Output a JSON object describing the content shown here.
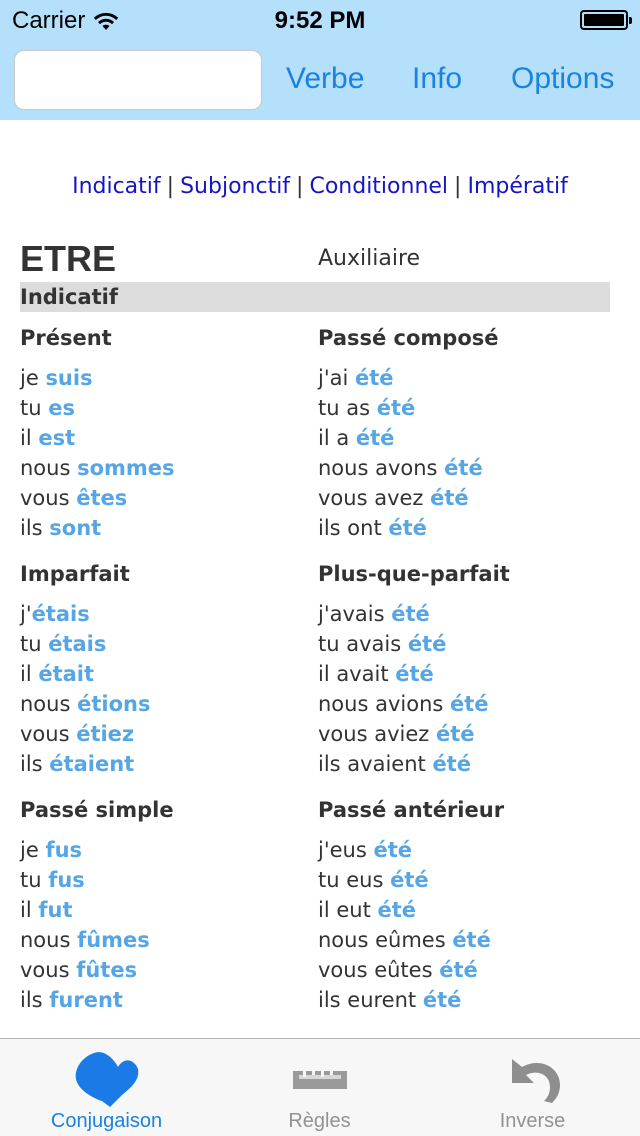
{
  "status_bar": {
    "carrier": "Carrier",
    "time": "9:52 PM"
  },
  "nav": {
    "search_value": "",
    "verbe": "Verbe",
    "info": "Info",
    "options": "Options"
  },
  "modes": [
    "Indicatif",
    "Subjonctif",
    "Conditionnel",
    "Impératif"
  ],
  "mode_separator": "|",
  "verb": {
    "name": "ETRE",
    "type": "Auxiliaire"
  },
  "mood_header": "Indicatif",
  "tenses": [
    {
      "title": "Présent",
      "forms": [
        [
          "je ",
          "suis"
        ],
        [
          "tu ",
          "es"
        ],
        [
          "il ",
          "est"
        ],
        [
          "nous ",
          "sommes"
        ],
        [
          "vous ",
          "êtes"
        ],
        [
          "ils ",
          "sont"
        ]
      ]
    },
    {
      "title": "Passé composé",
      "forms": [
        [
          "j'ai ",
          "été"
        ],
        [
          "tu as ",
          "été"
        ],
        [
          "il a ",
          "été"
        ],
        [
          "nous avons ",
          "été"
        ],
        [
          "vous avez ",
          "été"
        ],
        [
          "ils ont ",
          "été"
        ]
      ]
    },
    {
      "title": "Imparfait",
      "forms": [
        [
          "j'",
          "étais"
        ],
        [
          "tu ",
          "étais"
        ],
        [
          "il ",
          "était"
        ],
        [
          "nous ",
          "étions"
        ],
        [
          "vous ",
          "étiez"
        ],
        [
          "ils ",
          "étaient"
        ]
      ]
    },
    {
      "title": "Plus-que-parfait",
      "forms": [
        [
          "j'avais ",
          "été"
        ],
        [
          "tu avais ",
          "été"
        ],
        [
          "il avait ",
          "été"
        ],
        [
          "nous avions ",
          "été"
        ],
        [
          "vous aviez ",
          "été"
        ],
        [
          "ils avaient ",
          "été"
        ]
      ]
    },
    {
      "title": "Passé simple",
      "forms": [
        [
          "je ",
          "fus"
        ],
        [
          "tu ",
          "fus"
        ],
        [
          "il ",
          "fut"
        ],
        [
          "nous ",
          "fûmes"
        ],
        [
          "vous ",
          "fûtes"
        ],
        [
          "ils ",
          "furent"
        ]
      ]
    },
    {
      "title": "Passé antérieur",
      "forms": [
        [
          "j'eus ",
          "été"
        ],
        [
          "tu eus ",
          "été"
        ],
        [
          "il eut ",
          "été"
        ],
        [
          "nous eûmes ",
          "été"
        ],
        [
          "vous eûtes ",
          "été"
        ],
        [
          "ils eurent ",
          "été"
        ]
      ]
    }
  ],
  "tabs": [
    {
      "label": "Conjugaison",
      "icon": "heart-icon",
      "active": true
    },
    {
      "label": "Règles",
      "icon": "ruler-icon",
      "active": false
    },
    {
      "label": "Inverse",
      "icon": "undo-arrow-icon",
      "active": false
    }
  ],
  "colors": {
    "bar": "#b5e0fb",
    "accent": "#1a82e0",
    "link": "#1515c8",
    "verb_form": "#56a6e6",
    "tab_inactive": "#929292"
  }
}
